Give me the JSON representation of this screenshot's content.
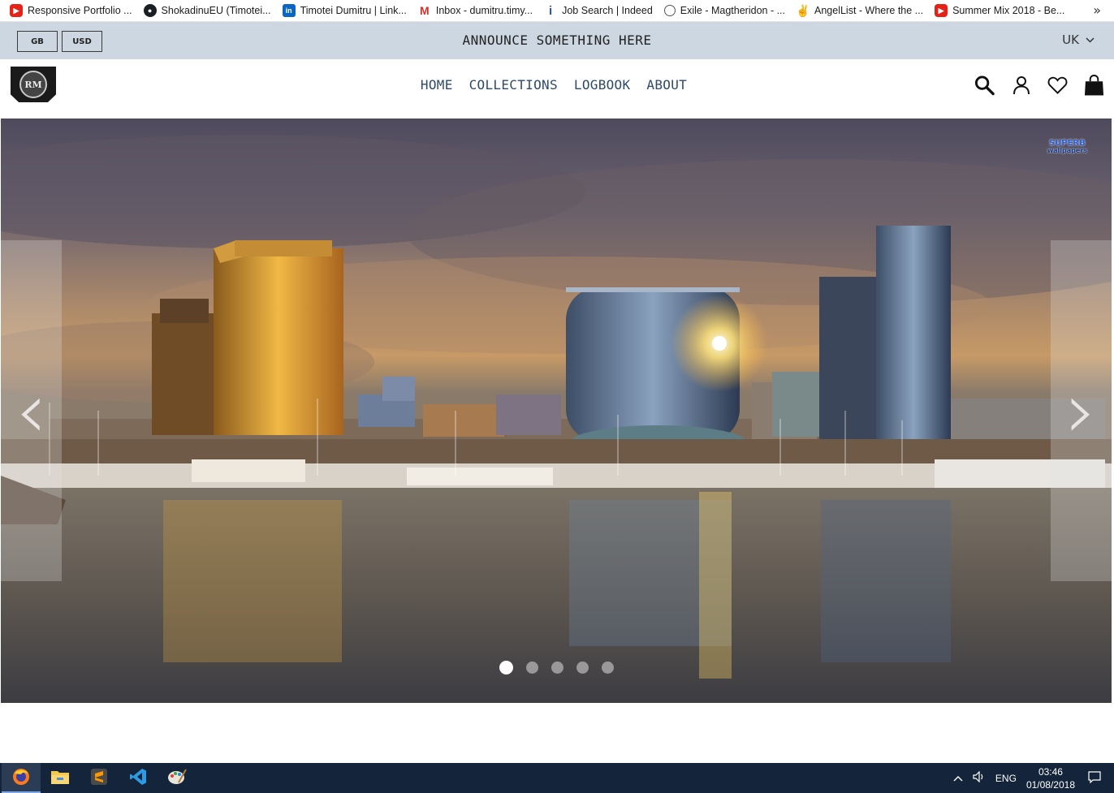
{
  "bookmarks": {
    "items": [
      {
        "label": "Responsive Portfolio ...",
        "icon": "youtube-icon"
      },
      {
        "label": "ShokadinuEU (Timotei...",
        "icon": "github-icon"
      },
      {
        "label": "Timotei Dumitru | Link...",
        "icon": "linkedin-icon"
      },
      {
        "label": "Inbox - dumitru.timy...",
        "icon": "gmail-icon"
      },
      {
        "label": "Job Search | Indeed",
        "icon": "indeed-icon"
      },
      {
        "label": "Exile - Magtheridon - ...",
        "icon": "globe-icon"
      },
      {
        "label": "AngelList - Where the ...",
        "icon": "angellist-icon"
      },
      {
        "label": "Summer Mix 2018 - Be...",
        "icon": "youtube-icon"
      }
    ],
    "more_label": "»"
  },
  "announce": {
    "language": "GB",
    "currency": "USD",
    "text": "ANNOUNCE SOMETHING HERE",
    "region": "UK"
  },
  "header": {
    "logo_text": "RM",
    "nav": [
      "HOME",
      "COLLECTIONS",
      "LOGBOOK",
      "ABOUT"
    ],
    "icons": [
      "search-icon",
      "account-icon",
      "wishlist-heart-icon",
      "cart-bag-icon"
    ]
  },
  "hero": {
    "prev_label": "‹",
    "next_label": "›",
    "slide_count": 5,
    "active_slide": 1,
    "watermark_line1": "SUPERB",
    "watermark_line2": "wallpapers"
  },
  "taskbar": {
    "apps": [
      "firefox-icon",
      "file-explorer-icon",
      "sublime-text-icon",
      "vscode-icon",
      "paint-icon"
    ],
    "language": "ENG",
    "time": "03:46",
    "date": "01/08/2018"
  }
}
